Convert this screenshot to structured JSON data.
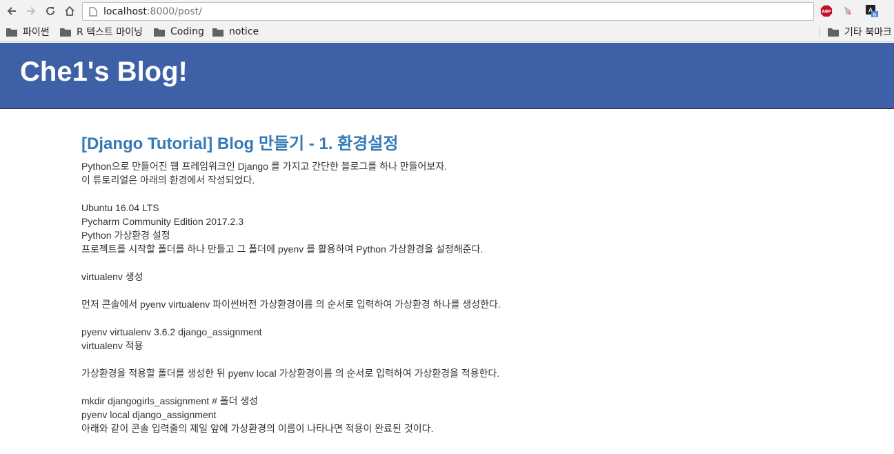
{
  "browser": {
    "url_host": "localhost",
    "url_rest": ":8000/post/",
    "extensions": [
      {
        "icon": "adblock-plus-icon",
        "label": "ABP"
      },
      {
        "icon": "cursor-extension-icon"
      },
      {
        "icon": "translate-extension-icon",
        "label": "A",
        "sub": "N"
      }
    ]
  },
  "bookmarks": {
    "items": [
      "파이썬",
      "R 텍스트 마이닝",
      "Coding",
      "notice"
    ],
    "other": "기타 북마크"
  },
  "header": {
    "title": "Che1's Blog!"
  },
  "post": {
    "title": "[Django Tutorial] Blog 만들기 - 1. 환경설정",
    "lines": [
      "Python으로 만들어진 웹 프레임워크인 Django 를 가지고 간단한 블로그를 하나 만들어보자.",
      "이 튜토리얼은 아래의 환경에서 작성되었다.",
      "",
      "Ubuntu 16.04 LTS",
      "Pycharm Community Edition 2017.2.3",
      "Python 가상환경 설정",
      "프로젝트를 시작할 폴더를 하나 만들고 그 폴더에 pyenv 를 활용하여 Python 가상환경을 설정해준다.",
      "",
      "virtualenv 생성",
      "",
      "먼저 콘솔에서 pyenv virtualenv 파이썬버전 가상환경이름 의 순서로 입력하여 가상환경 하나를 생성한다.",
      "",
      "pyenv virtualenv 3.6.2 django_assignment",
      "virtualenv 적용",
      "",
      "가상환경을 적용할 폴더를 생성한 뒤 pyenv local 가상환경이름 의 순서로 입력하여 가상환경을 적용한다.",
      "",
      "mkdir djangogirls_assignment # 폴더 생성",
      "pyenv local django_assignment",
      "아래와 같이 콘솔 입력줄의 제일 앞에 가상환경의 이름이 나타나면 적용이 완료된 것이다."
    ]
  },
  "colors": {
    "header_bg": "#3d60a7",
    "title_link": "#337ab7",
    "body_text": "#333333"
  }
}
